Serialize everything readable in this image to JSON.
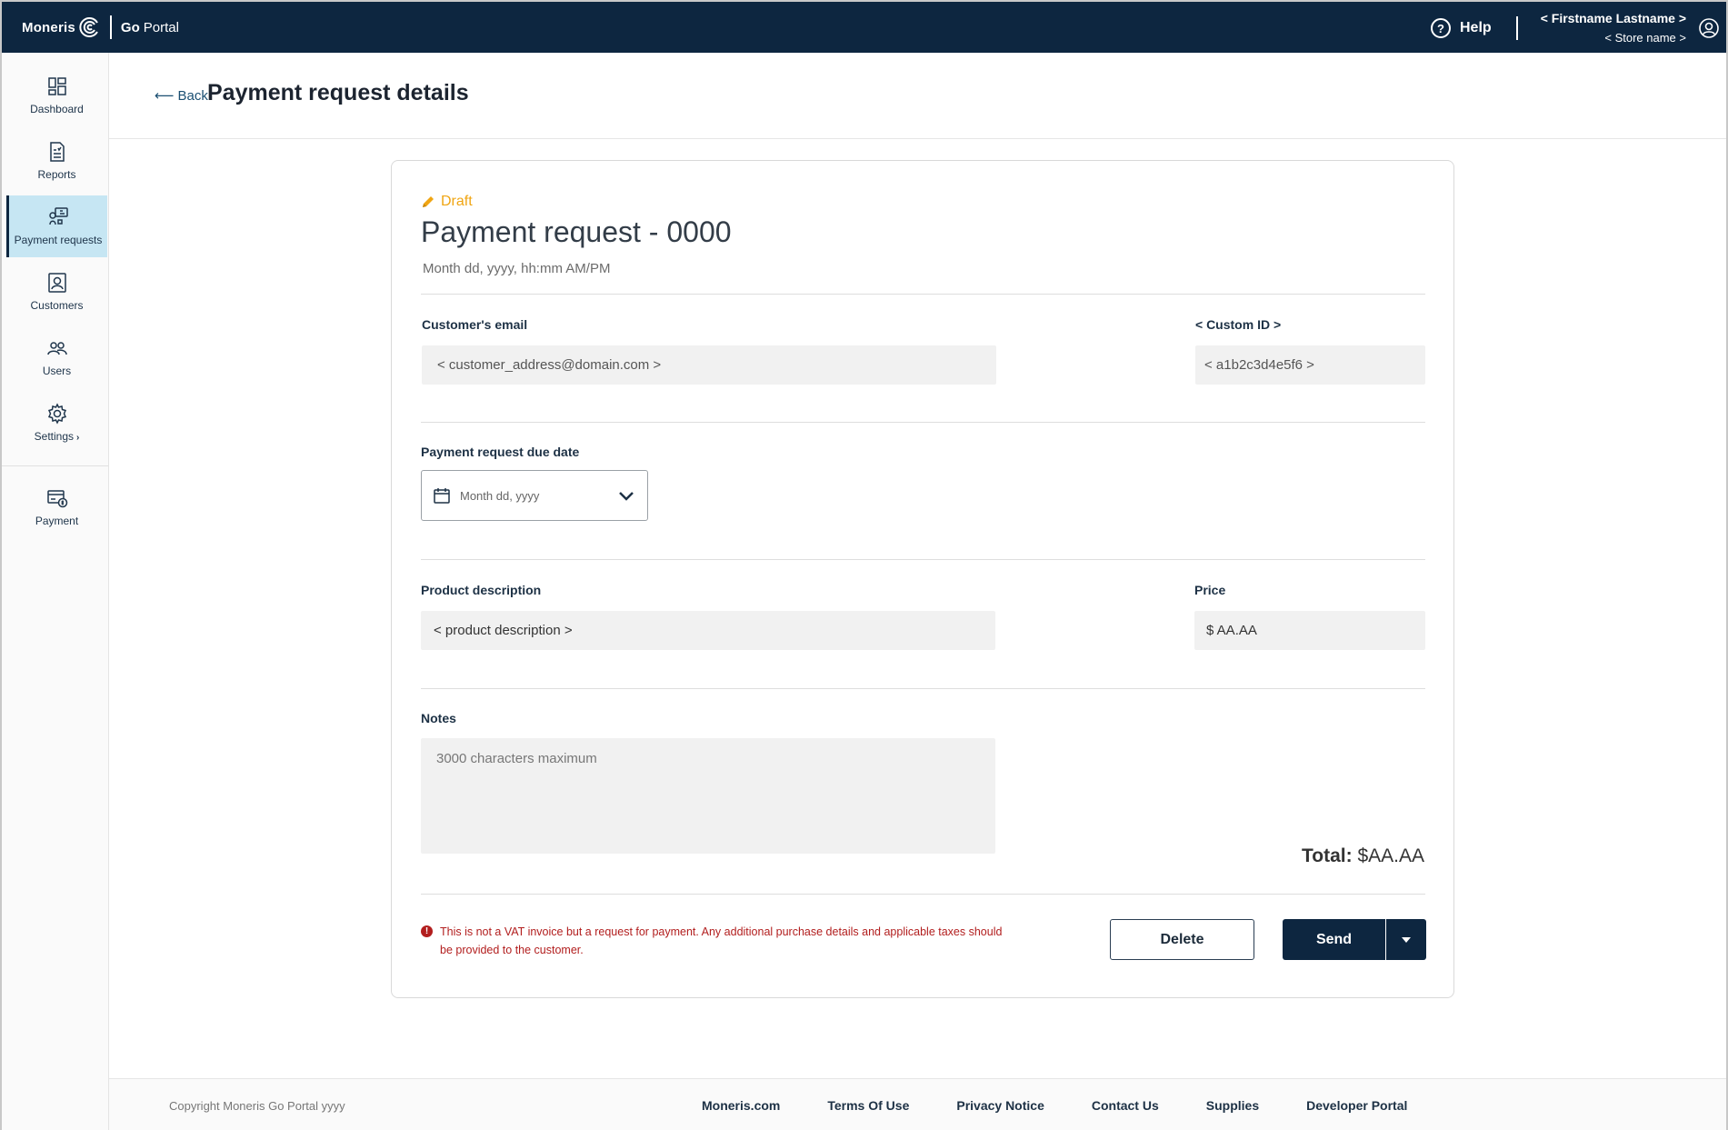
{
  "app": {
    "brand": "Moneris",
    "product_go": "Go",
    "product_portal": "Portal"
  },
  "topbar": {
    "help_label": "Help",
    "user_name": "< Firstname Lastname >",
    "store_name": "< Store name >"
  },
  "sidebar": {
    "items": [
      {
        "label": "Dashboard",
        "icon": "dashboard-icon"
      },
      {
        "label": "Reports",
        "icon": "reports-icon"
      },
      {
        "label": "Payment requests",
        "icon": "payment-requests-icon",
        "active": true
      },
      {
        "label": "Customers",
        "icon": "customers-icon"
      },
      {
        "label": "Users",
        "icon": "users-icon"
      },
      {
        "label": "Settings",
        "icon": "settings-icon"
      },
      {
        "label": "Payment",
        "icon": "payment-icon"
      }
    ]
  },
  "header": {
    "back_label": "Back",
    "title": "Payment request details"
  },
  "request": {
    "status": "Draft",
    "title": "Payment request - 0000",
    "date": "Month dd, yyyy,  hh:mm AM/PM",
    "email_label": "Customer's email",
    "email_value": "< customer_address@domain.com >",
    "custom_id_label": "< Custom ID >",
    "custom_id_value": "< a1b2c3d4e5f6 >",
    "due_date_label": "Payment request due date",
    "due_date_placeholder": "Month dd, yyyy",
    "product_label": "Product description",
    "product_value": "< product description >",
    "price_label": "Price",
    "price_value": "$ AA.AA",
    "notes_label": "Notes",
    "notes_placeholder": "3000 characters maximum",
    "total_label": "Total:",
    "total_value": "$AA.AA",
    "disclaimer": "This is not a VAT invoice but a request for payment. Any additional purchase details and applicable taxes should be provided to the customer.",
    "delete_label": "Delete",
    "send_label": "Send"
  },
  "footer": {
    "copyright": "Copyright Moneris Go Portal  yyyy",
    "links": [
      "Moneris.com",
      "Terms Of Use",
      "Privacy Notice",
      "Contact Us",
      "Supplies",
      "Developer Portal"
    ]
  },
  "colors": {
    "topbar": "#0d2640",
    "active_nav": "#c6e6f3",
    "draft": "#f0a512",
    "warning": "#b21e1e"
  }
}
